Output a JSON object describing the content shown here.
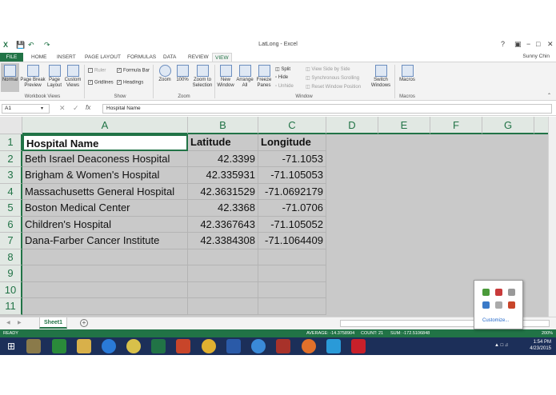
{
  "app": {
    "title": "LatLong - Excel",
    "user": "Sunny Chin",
    "help": "?",
    "minimize": "−",
    "restore": "□",
    "close": "✕"
  },
  "ribbon_tabs": [
    "FILE",
    "HOME",
    "INSERT",
    "PAGE LAYOUT",
    "FORMULAS",
    "DATA",
    "REVIEW",
    "VIEW"
  ],
  "ribbon": {
    "workbook_views": {
      "group": "Workbook Views",
      "normal": "Normal",
      "page_break": "Page Break Preview",
      "page_layout": "Page Layout",
      "custom_views": "Custom Views"
    },
    "show": {
      "group": "Show",
      "ruler": "Ruler",
      "formula_bar": "Formula Bar",
      "gridlines": "Gridlines",
      "headings": "Headings"
    },
    "zoom": {
      "group": "Zoom",
      "zoom": "Zoom",
      "zoom100": "100%",
      "zoom_selection": "Zoom to Selection"
    },
    "window": {
      "group": "Window",
      "new_window": "New Window",
      "arrange_all": "Arrange All",
      "freeze_panes": "Freeze Panes",
      "split": "Split",
      "hide": "Hide",
      "unhide": "Unhide",
      "side_by_side": "View Side by Side",
      "sync_scroll": "Synchronous Scrolling",
      "reset_pos": "Reset Window Position",
      "switch_windows": "Switch Windows"
    },
    "macros": {
      "group": "Macros",
      "macros": "Macros"
    }
  },
  "formula_bar": {
    "name_box": "A1",
    "fx": "fx",
    "content": "Hospital Name"
  },
  "columns": [
    "A",
    "B",
    "C",
    "D",
    "E",
    "F",
    "G"
  ],
  "rows": [
    "1",
    "2",
    "3",
    "4",
    "5",
    "6",
    "7",
    "8",
    "9",
    "10",
    "11"
  ],
  "table": {
    "headers": [
      "Hospital Name",
      "Latitude",
      "Longitude"
    ],
    "data": [
      [
        "Beth Israel Deaconess Hospital",
        "42.3399",
        "-71.1053"
      ],
      [
        "Brigham & Women's Hospital",
        "42.335931",
        "-71.105053"
      ],
      [
        "Massachusetts General Hospital",
        "42.3631529",
        "-71.0692179"
      ],
      [
        "Boston Medical Center",
        "42.3368",
        "-71.0706"
      ],
      [
        "Children's Hospital",
        "42.3367643",
        "-71.105052"
      ],
      [
        "Dana-Farber Cancer Institute",
        "42.3384308",
        "-71.1064409"
      ]
    ]
  },
  "sheets": [
    "Sheet1"
  ],
  "status": {
    "mode": "READY",
    "average": "AVERAGE: -14.3758904",
    "count": "COUNT: 21",
    "sum": "SUM: -172.5106848",
    "zoom": "200%"
  },
  "tray": {
    "customize": "Customize..."
  },
  "clock": {
    "time": "1:54 PM",
    "date": "4/23/2015"
  },
  "colors": {
    "excel_green": "#217346",
    "taskbar": "#1c2f59",
    "grid_gray": "#c9c9c9"
  }
}
